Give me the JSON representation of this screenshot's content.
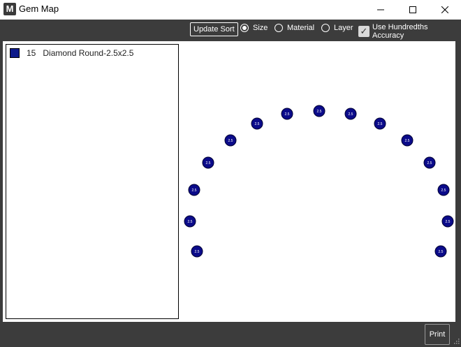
{
  "window": {
    "title": "Gem Map",
    "app_icon_letter": "M"
  },
  "toolbar": {
    "update_sort_label": "Update Sort",
    "sort_options": [
      {
        "label": "Size",
        "selected": true
      },
      {
        "label": "Material",
        "selected": false
      },
      {
        "label": "Layer",
        "selected": false
      }
    ],
    "hundredths_label": "Use Hundredths Accuracy",
    "hundredths_checked": true
  },
  "gem_list": [
    {
      "count": "15",
      "name": "Diamond Round-2.5x2.5",
      "color": "#0d1a8a"
    }
  ],
  "gem_map": {
    "gem_color": "#0b0b8a",
    "gems": [
      {
        "label": "2.5"
      },
      {
        "label": "2.5"
      },
      {
        "label": "2.5"
      },
      {
        "label": "2.5"
      },
      {
        "label": "2.5"
      },
      {
        "label": "2.5"
      },
      {
        "label": "2.5"
      },
      {
        "label": "2.5"
      },
      {
        "label": "2.5"
      },
      {
        "label": "2.5"
      },
      {
        "label": "2.5"
      },
      {
        "label": "2.5"
      },
      {
        "label": "2.5"
      },
      {
        "label": "2.5"
      },
      {
        "label": "2.5"
      }
    ]
  },
  "footer": {
    "print_label": "Print"
  }
}
